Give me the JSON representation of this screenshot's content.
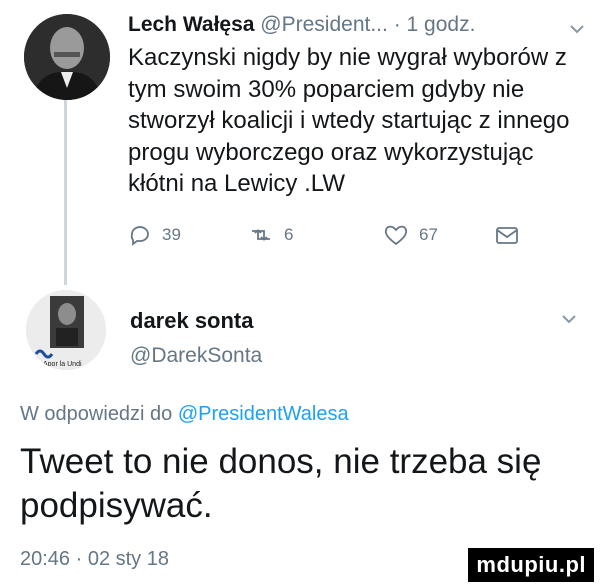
{
  "tweet1": {
    "name": "Lech Wałęsa",
    "handle": "@President...",
    "separator": "·",
    "time": "1 godz.",
    "text": "Kaczynski nigdy by nie wygrał wyborów z tym swoim 30% poparciem gdyby nie stworzył koalicji i wtedy startując z innego progu wyborczego oraz wykorzystując  kłótni na Lewicy .LW",
    "actions": {
      "replies": "39",
      "retweets": "6",
      "likes": "67"
    }
  },
  "tweet2": {
    "name": "darek sonta",
    "handle": "@DarekSonta",
    "reply_prefix": "W odpowiedzi do ",
    "reply_mention": "@PresidentWalesa",
    "text": "Tweet to nie donos, nie trzeba się podpisywać.",
    "timestamp": "20:46 · 02 sty 18",
    "avatar_text": "Apor la Undi"
  },
  "watermark": "mdupiu.pl",
  "colors": {
    "link": "#1da1f2",
    "muted": "#657786",
    "text": "#14171a",
    "line": "#ccd6dd"
  }
}
